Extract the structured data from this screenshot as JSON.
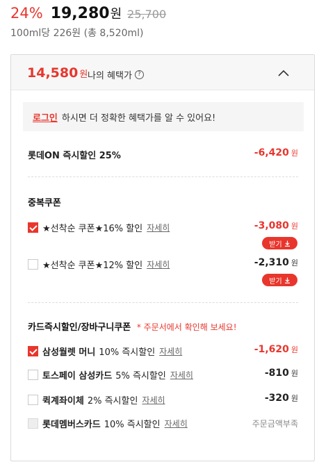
{
  "price": {
    "discount_rate": "24%",
    "sale_price": "19,280",
    "won": "원",
    "original_price": "25,700",
    "unit_price": "100ml당 226원 (총 8,520ml)"
  },
  "benefit": {
    "amount": "14,580",
    "won": "원",
    "label": "나의 혜택가",
    "help_icon": "?"
  },
  "login_banner": {
    "link": "로그인",
    "text": "하시면 더 정확한 혜택가를 알 수 있어요!"
  },
  "instant_discount": {
    "label": "롯데ON 즉시할인 25%",
    "amount": "-6,420",
    "won": "원"
  },
  "coupons": {
    "title": "중복쿠폰",
    "items": [
      {
        "label": "★선착순 쿠폰★16% 할인",
        "detail": "자세히",
        "amount": "-3,080",
        "won": "원",
        "checked": true,
        "button": "받기"
      },
      {
        "label": "★선착순 쿠폰★12% 할인",
        "detail": "자세히",
        "amount": "-2,310",
        "won": "원",
        "checked": false,
        "button": "받기"
      }
    ]
  },
  "card_discounts": {
    "title": "카드즉시할인/장바구니쿠폰",
    "note": "* 주문서에서 확인해 보세요!",
    "items": [
      {
        "card": "삼성월렛 머니",
        "desc": "10% 즉시할인",
        "detail": "자세히",
        "amount": "-1,620",
        "won": "원",
        "state": "checked"
      },
      {
        "card": "토스페이 삼성카드",
        "desc": "5% 즉시할인",
        "detail": "자세히",
        "amount": "-810",
        "won": "원",
        "state": "unchecked"
      },
      {
        "card": "퀵계좌이체",
        "desc": "2% 즉시할인",
        "detail": "자세히",
        "amount": "-320",
        "won": "원",
        "state": "unchecked"
      },
      {
        "card": "롯데멤버스카드",
        "desc": "10% 즉시할인",
        "detail": "자세히",
        "status": "주문금액부족",
        "state": "disabled"
      }
    ]
  },
  "icons": {
    "collapse": "chevron-up-icon",
    "download": "download-icon"
  },
  "colors": {
    "accent": "#e8362d",
    "text": "#222222",
    "muted": "#888888",
    "panel_header_bg": "#f7f7f7"
  }
}
